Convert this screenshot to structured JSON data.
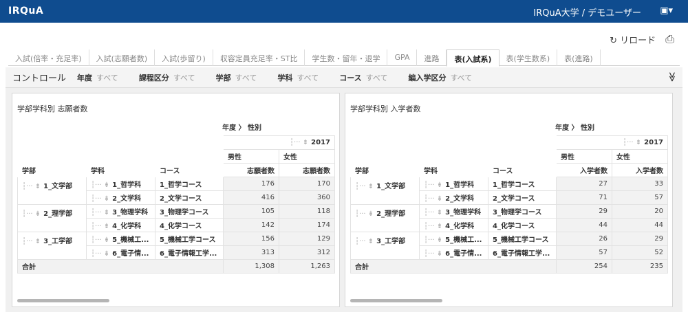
{
  "app": {
    "logo": "IRQuA",
    "user": "IRQuA大学 / デモユーザー",
    "user_tools": "▣▾"
  },
  "toolbar": {
    "reload_icon": "↻",
    "reload_label": "リロード",
    "print_icon": "⎙"
  },
  "tabs": [
    {
      "label": "入試(倍率・充足率)"
    },
    {
      "label": "入試(志願者数)"
    },
    {
      "label": "入試(歩留り)"
    },
    {
      "label": "収容定員充足率・ST比"
    },
    {
      "label": "学生数・留年・退学"
    },
    {
      "label": "GPA"
    },
    {
      "label": "進路"
    },
    {
      "label": "表(入試系)"
    },
    {
      "label": "表(学生数系)"
    },
    {
      "label": "表(進路)"
    }
  ],
  "control": {
    "title": "コントロール",
    "filters": [
      {
        "key": "年度",
        "value": "すべて"
      },
      {
        "key": "課程区分",
        "value": "すべて"
      },
      {
        "key": "学部",
        "value": "すべて"
      },
      {
        "key": "学科",
        "value": "すべて"
      },
      {
        "key": "コース",
        "value": "すべて"
      },
      {
        "key": "編入学区分",
        "value": "すべて"
      }
    ],
    "collapse_icon": "≫"
  },
  "tree_icon": "┆··· ⇟",
  "panels": [
    {
      "title": "学部学科別 志願者数",
      "axis": "年度  〉 性別",
      "year": "2017",
      "genders": [
        "男性",
        "女性"
      ],
      "measure": [
        "志願者数",
        "志願者数"
      ],
      "cols": [
        "学部",
        "学科",
        "コース"
      ],
      "rows": [
        {
          "fac": "1_文学部",
          "dept": "1_哲学科",
          "course": "1_哲学コース",
          "m": "176",
          "f": "170"
        },
        {
          "fac": "",
          "dept": "2_文学科",
          "course": "2_文学コース",
          "m": "416",
          "f": "360"
        },
        {
          "fac": "2_理学部",
          "dept": "3_物理学科",
          "course": "3_物理学コース",
          "m": "105",
          "f": "118"
        },
        {
          "fac": "",
          "dept": "4_化学科",
          "course": "4_化学コース",
          "m": "142",
          "f": "174"
        },
        {
          "fac": "3_工学部",
          "dept": "5_機械工...",
          "course": "5_機械工学コース",
          "m": "156",
          "f": "129"
        },
        {
          "fac": "",
          "dept": "6_電子情...",
          "course": "6_電子情報工学...",
          "m": "313",
          "f": "312"
        }
      ],
      "total": {
        "label": "合計",
        "m": "1,308",
        "f": "1,263"
      }
    },
    {
      "title": "学部学科別 入学者数",
      "axis": "年度  〉 性別",
      "year": "2017",
      "genders": [
        "男性",
        "女性"
      ],
      "measure": [
        "入学者数",
        "入学者数"
      ],
      "cols": [
        "学部",
        "学科",
        "コース"
      ],
      "rows": [
        {
          "fac": "1_文学部",
          "dept": "1_哲学科",
          "course": "1_哲学コース",
          "m": "27",
          "f": "33"
        },
        {
          "fac": "",
          "dept": "2_文学科",
          "course": "2_文学コース",
          "m": "71",
          "f": "57"
        },
        {
          "fac": "2_理学部",
          "dept": "3_物理学科",
          "course": "3_物理学コース",
          "m": "29",
          "f": "20"
        },
        {
          "fac": "",
          "dept": "4_化学科",
          "course": "4_化学コース",
          "m": "44",
          "f": "44"
        },
        {
          "fac": "3_工学部",
          "dept": "5_機械工...",
          "course": "5_機械工学コース",
          "m": "26",
          "f": "29"
        },
        {
          "fac": "",
          "dept": "6_電子情...",
          "course": "6_電子情報工学...",
          "m": "57",
          "f": "52"
        }
      ],
      "total": {
        "label": "合計",
        "m": "254",
        "f": "235"
      }
    }
  ]
}
